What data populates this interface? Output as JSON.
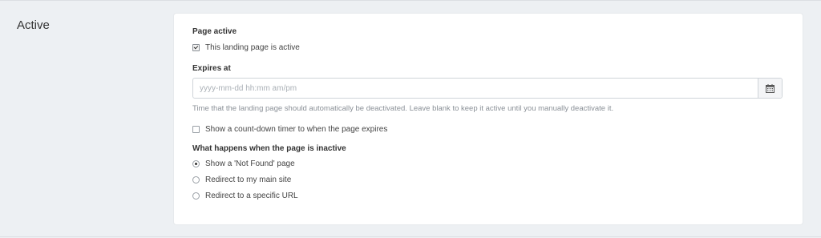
{
  "section": {
    "title": "Active"
  },
  "page_active": {
    "label": "Page active",
    "checkbox_label": "This landing page is active",
    "checked": true
  },
  "expires_at": {
    "label": "Expires at",
    "placeholder": "yyyy-mm-dd hh:mm am/pm",
    "value": "",
    "calendar_icon": "calendar-icon",
    "help": "Time that the landing page should automatically be deactivated. Leave blank to keep it active until you manually deactivate it."
  },
  "countdown": {
    "label": "Show a count-down timer to when the page expires",
    "checked": false
  },
  "inactive": {
    "label": "What happens when the page is inactive",
    "options": [
      {
        "label": "Show a 'Not Found' page",
        "selected": true
      },
      {
        "label": "Redirect to my main site",
        "selected": false
      },
      {
        "label": "Redirect to a specific URL",
        "selected": false
      }
    ]
  }
}
